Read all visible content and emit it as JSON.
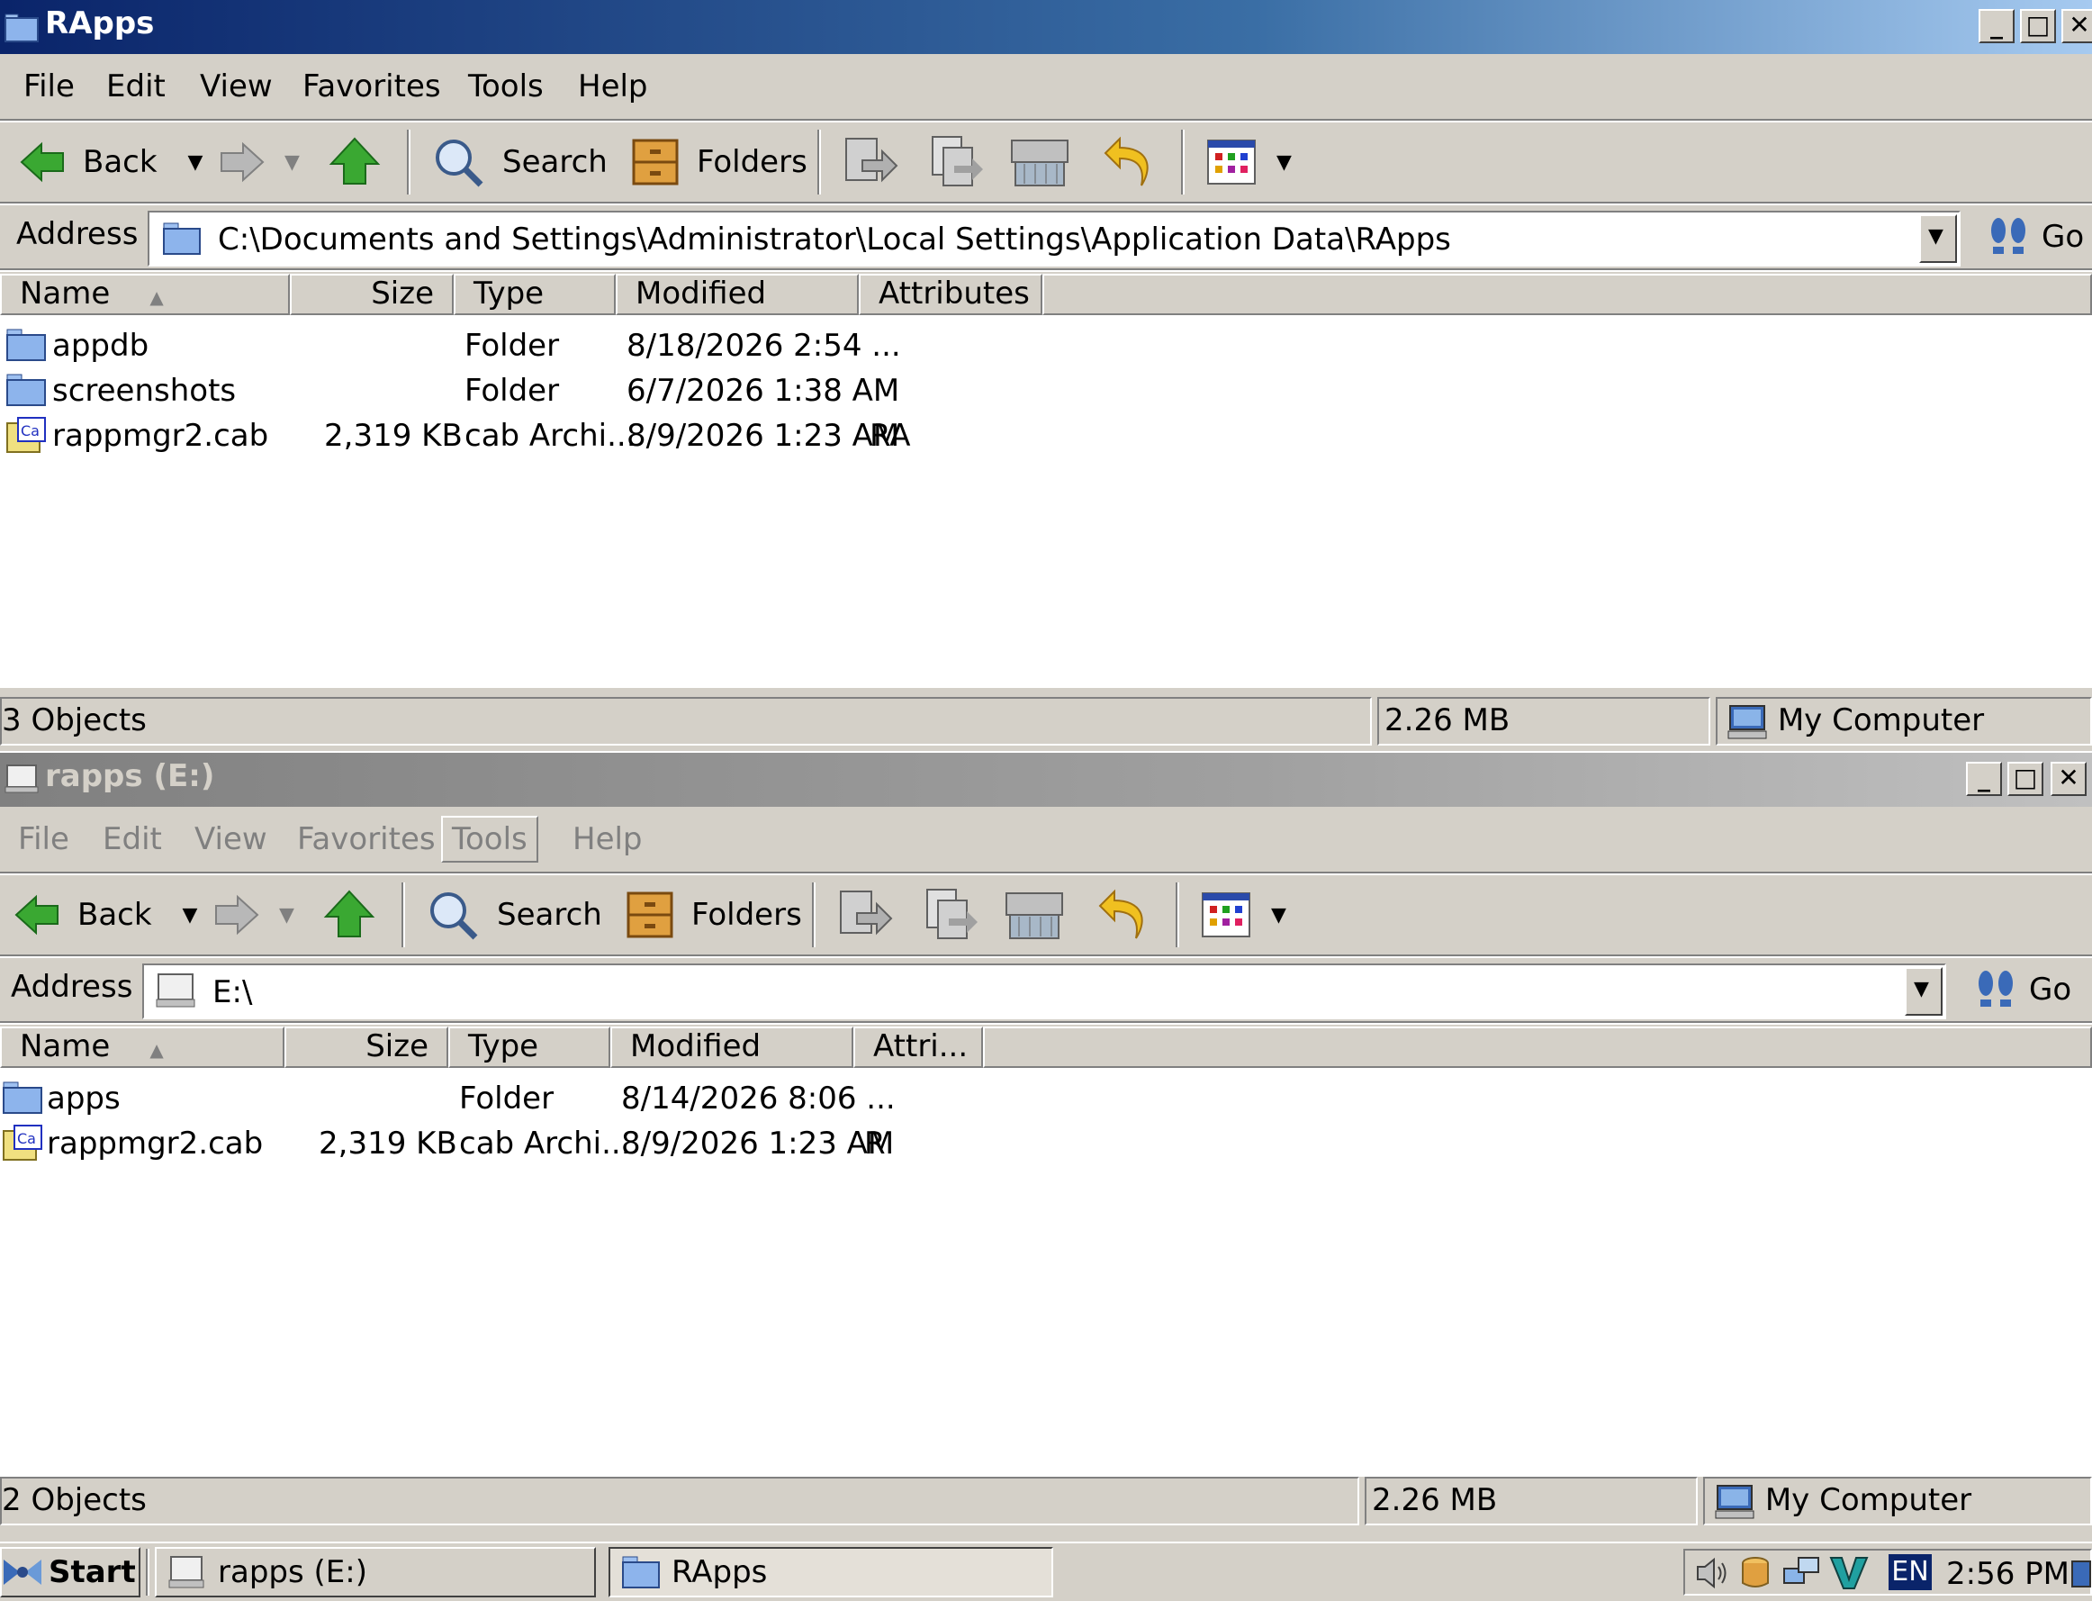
{
  "window1": {
    "title": "RApps",
    "menus": [
      "File",
      "Edit",
      "View",
      "Favorites",
      "Tools",
      "Help"
    ],
    "toolbar": {
      "back": "Back",
      "search": "Search",
      "folders": "Folders"
    },
    "address_label": "Address",
    "address_value": "C:\\Documents and Settings\\Administrator\\Local Settings\\Application Data\\RApps",
    "go_label": "Go",
    "columns": [
      "Name",
      "Size",
      "Type",
      "Modified",
      "Attributes"
    ],
    "rows": [
      {
        "name": "appdb",
        "size": "",
        "type": "Folder",
        "modified": "8/18/2026 2:54 ...",
        "attributes": "",
        "icon": "folder-icon"
      },
      {
        "name": "screenshots",
        "size": "",
        "type": "Folder",
        "modified": "6/7/2026 1:38 AM",
        "attributes": "",
        "icon": "folder-icon"
      },
      {
        "name": "rappmgr2.cab",
        "size": "2,319 KB",
        "type": "cab Archi...",
        "modified": "8/9/2026 1:23 AM",
        "attributes": "RA",
        "icon": "cab-file-icon"
      }
    ],
    "status": {
      "objects": "3 Objects",
      "size": "2.26 MB",
      "zone": "My Computer"
    }
  },
  "window2": {
    "title": "rapps (E:)",
    "menus": [
      "File",
      "Edit",
      "View",
      "Favorites",
      "Tools",
      "Help"
    ],
    "toolbar": {
      "back": "Back",
      "search": "Search",
      "folders": "Folders"
    },
    "address_label": "Address",
    "address_value": "E:\\",
    "go_label": "Go",
    "columns": [
      "Name",
      "Size",
      "Type",
      "Modified",
      "Attri..."
    ],
    "rows": [
      {
        "name": "apps",
        "size": "",
        "type": "Folder",
        "modified": "8/14/2026 8:06 ...",
        "attributes": "",
        "icon": "folder-icon"
      },
      {
        "name": "rappmgr2.cab",
        "size": "2,319 KB",
        "type": "cab Archi...",
        "modified": "8/9/2026 1:23 AM",
        "attributes": "R",
        "icon": "cab-file-icon"
      }
    ],
    "status": {
      "objects": "2 Objects",
      "size": "2.26 MB",
      "zone": "My Computer"
    }
  },
  "taskbar": {
    "start_label": "Start",
    "tasks": [
      "rapps (E:)",
      "RApps"
    ],
    "language": "EN",
    "clock": "2:56 PM"
  },
  "colors": {
    "active_title_start": "#0a246a",
    "active_title_end": "#a6caf0",
    "inactive_title": "#808080",
    "face": "#d4d0c8"
  }
}
